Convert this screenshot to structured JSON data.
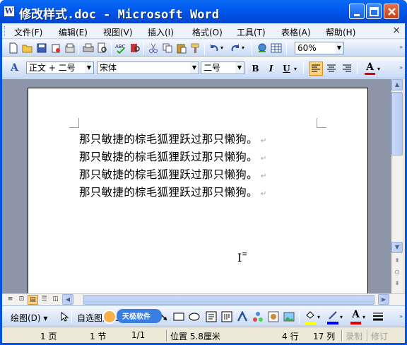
{
  "window": {
    "icon_letter": "W",
    "title": "修改样式.doc - Microsoft Word"
  },
  "menu": {
    "items": [
      "文件(F)",
      "编辑(E)",
      "视图(V)",
      "插入(I)",
      "格式(O)",
      "工具(T)",
      "表格(A)",
      "帮助(H)"
    ],
    "close_glyph": "×"
  },
  "standard_toolbar": {
    "zoom": "60%"
  },
  "format_toolbar": {
    "style": "正文 + 二号",
    "font": "宋体",
    "size": "二号",
    "bold": "B",
    "italic": "I",
    "underline": "U",
    "font_color_letter": "A"
  },
  "document": {
    "lines": [
      "那只敏捷的棕毛狐狸跃过那只懒狗。",
      "那只敏捷的棕毛狐狸跃过那只懒狗。",
      "那只敏捷的棕毛狐狸跃过那只懒狗。",
      "那只敏捷的棕毛狐狸跃过那只懒狗。"
    ],
    "para_mark": "↵"
  },
  "drawing_toolbar": {
    "draw_label": "绘图(D)",
    "autoshapes_label": "自选图形(U)",
    "watermark_text": "天极软件"
  },
  "status_bar": {
    "page": "1 页",
    "section": "1 节",
    "page_of": "1/1",
    "position": "位置 5.8厘米",
    "line": "4 行",
    "column": "17 列",
    "record": "录制",
    "revise": "修订"
  },
  "colors": {
    "title_bar": "#0058ee",
    "toolbar": "#c9daf5",
    "doc_background": "#8c96a8",
    "font_color_red": "#e00000",
    "highlight_yellow": "#ffff00"
  }
}
